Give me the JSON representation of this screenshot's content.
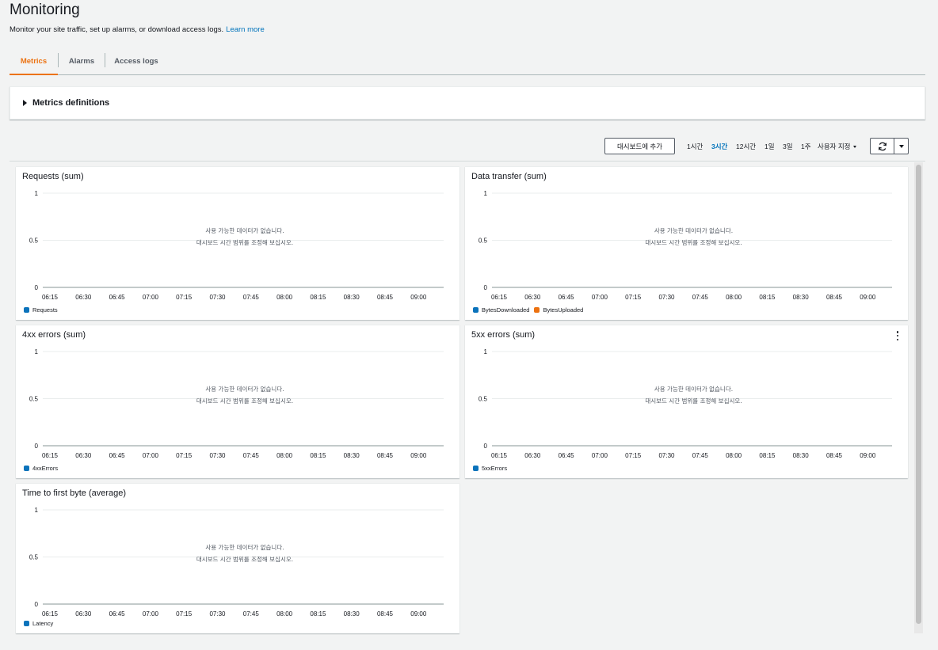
{
  "header": {
    "title": "Monitoring",
    "description": "Monitor your site traffic, set up alarms, or download access logs.",
    "learn_more": "Learn more"
  },
  "tabs": [
    {
      "label": "Metrics",
      "active": true
    },
    {
      "label": "Alarms",
      "active": false
    },
    {
      "label": "Access logs",
      "active": false
    }
  ],
  "metrics_definitions": {
    "label": "Metrics definitions"
  },
  "toolbar": {
    "add_to_dashboard": "대시보드에 추가",
    "ranges": [
      {
        "label": "1시간",
        "active": false
      },
      {
        "label": "3시간",
        "active": true
      },
      {
        "label": "12시간",
        "active": false
      },
      {
        "label": "1일",
        "active": false
      },
      {
        "label": "3일",
        "active": false
      },
      {
        "label": "1주",
        "active": false
      },
      {
        "label": "사용자 지정",
        "active": false
      }
    ],
    "refresh_icon": "refresh-icon",
    "dropdown_icon": "caret-down-icon"
  },
  "nodata": {
    "line1": "사용 가능한 데이터가 없습니다.",
    "line2": "대시보드 시간 범위를 조정해 보십시오."
  },
  "colors": {
    "tab_active": "#ec7211",
    "link": "#0073bb",
    "series_blue": "#0b73bb",
    "series_orange": "#ec7211"
  },
  "chart_data": [
    {
      "type": "line",
      "title": "Requests (sum)",
      "x": [
        "06:15",
        "06:30",
        "06:45",
        "07:00",
        "07:15",
        "07:30",
        "07:45",
        "08:00",
        "08:15",
        "08:30",
        "08:45",
        "09:00"
      ],
      "yticks": [
        "1",
        "0.5",
        "0"
      ],
      "ylim": [
        0,
        1
      ],
      "series": [
        {
          "name": "Requests",
          "values": [],
          "color": "#0b73bb"
        }
      ]
    },
    {
      "type": "line",
      "title": "Data transfer (sum)",
      "x": [
        "06:15",
        "06:30",
        "06:45",
        "07:00",
        "07:15",
        "07:30",
        "07:45",
        "08:00",
        "08:15",
        "08:30",
        "08:45",
        "09:00"
      ],
      "yticks": [
        "1",
        "0.5",
        "0"
      ],
      "ylim": [
        0,
        1
      ],
      "series": [
        {
          "name": "BytesDownloaded",
          "values": [],
          "color": "#0b73bb"
        },
        {
          "name": "BytesUploaded",
          "values": [],
          "color": "#ec7211"
        }
      ]
    },
    {
      "type": "line",
      "title": "4xx errors (sum)",
      "x": [
        "06:15",
        "06:30",
        "06:45",
        "07:00",
        "07:15",
        "07:30",
        "07:45",
        "08:00",
        "08:15",
        "08:30",
        "08:45",
        "09:00"
      ],
      "yticks": [
        "1",
        "0.5",
        "0"
      ],
      "ylim": [
        0,
        1
      ],
      "series": [
        {
          "name": "4xxErrors",
          "values": [],
          "color": "#0b73bb"
        }
      ]
    },
    {
      "type": "line",
      "title": "5xx errors (sum)",
      "x": [
        "06:15",
        "06:30",
        "06:45",
        "07:00",
        "07:15",
        "07:30",
        "07:45",
        "08:00",
        "08:15",
        "08:30",
        "08:45",
        "09:00"
      ],
      "yticks": [
        "1",
        "0.5",
        "0"
      ],
      "ylim": [
        0,
        1
      ],
      "series": [
        {
          "name": "5xxErrors",
          "values": [],
          "color": "#0b73bb"
        }
      ]
    },
    {
      "type": "line",
      "title": "Time to first byte (average)",
      "x": [
        "06:15",
        "06:30",
        "06:45",
        "07:00",
        "07:15",
        "07:30",
        "07:45",
        "08:00",
        "08:15",
        "08:30",
        "08:45",
        "09:00"
      ],
      "yticks": [
        "1",
        "0.5",
        "0"
      ],
      "ylim": [
        0,
        1
      ],
      "series": [
        {
          "name": "Latency",
          "values": [],
          "color": "#0b73bb"
        }
      ]
    }
  ]
}
